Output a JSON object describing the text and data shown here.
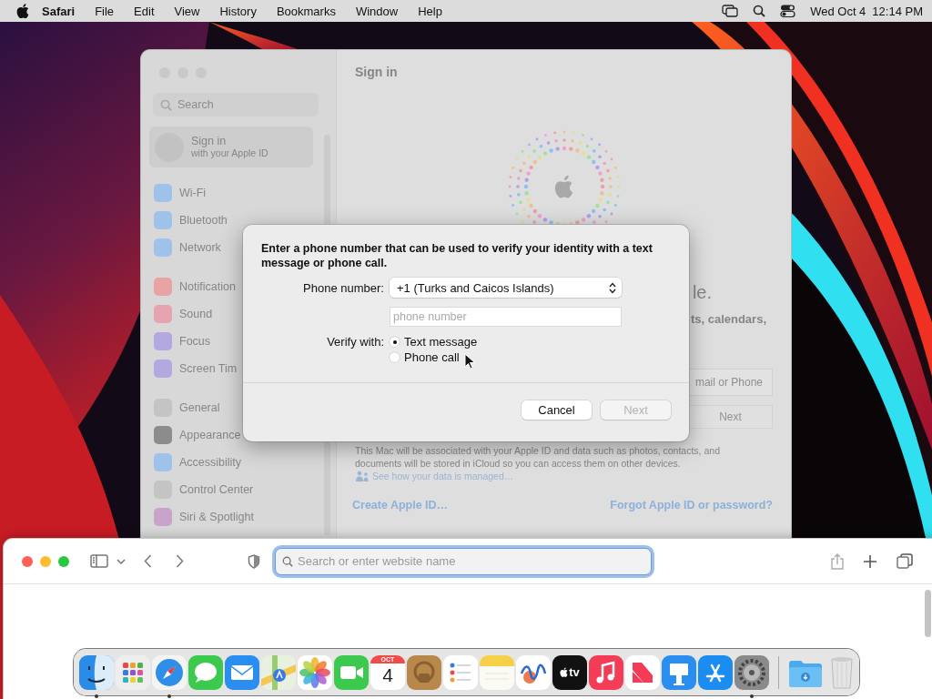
{
  "menu_bar": {
    "app_name": "Safari",
    "menus": [
      "File",
      "Edit",
      "View",
      "History",
      "Bookmarks",
      "Window",
      "Help"
    ],
    "date": "Wed Oct 4",
    "time": "12:14 PM"
  },
  "settings_window": {
    "active": false,
    "search": {
      "placeholder": "Search"
    },
    "account": {
      "title": "Sign in",
      "subtitle": "with your Apple ID"
    },
    "sidebar_groups": [
      [
        {
          "label": "Wi-Fi",
          "color": "#9fc2ea"
        },
        {
          "label": "Bluetooth",
          "color": "#9fc2ea"
        },
        {
          "label": "Network",
          "color": "#9fc2ea"
        }
      ],
      [
        {
          "label": "Notification",
          "color": "#e8a3a3"
        },
        {
          "label": "Sound",
          "color": "#e8a3b0"
        },
        {
          "label": "Focus",
          "color": "#b3a8e0"
        },
        {
          "label": "Screen Tim",
          "color": "#b3a8e0"
        }
      ],
      [
        {
          "label": "General",
          "color": "#c4c4c4"
        },
        {
          "label": "Appearance",
          "color": "#8c8c8c"
        },
        {
          "label": "Accessibility",
          "color": "#9fc2ea"
        },
        {
          "label": "Control Center",
          "color": "#c4c4c4"
        },
        {
          "label": "Siri & Spotlight",
          "color": "#c9a3c9"
        }
      ]
    ],
    "title": "Sign in",
    "headline_fragment": "le.",
    "subtitle_fragment": "ts, calendars,",
    "account_field": {
      "placeholder": "mail or Phone"
    },
    "next_button": {
      "label": "Next",
      "disabled": true
    },
    "info_text": "This Mac will be associated with your Apple ID and data such as photos, contacts, and documents will be stored in iCloud so you can access them on other devices.",
    "data_link": "See how your data is managed…",
    "create_link": "Create Apple ID…",
    "forgot_link": "Forgot Apple ID or password?"
  },
  "dialog": {
    "message": "Enter a phone number that can be used to verify your identity with a text message or phone call.",
    "phone_label": "Phone number:",
    "country": "+1 (Turks and Caicos Islands)",
    "phone_field": {
      "placeholder": "phone number"
    },
    "verify_label": "Verify with:",
    "verify_options": [
      {
        "label": "Text message",
        "selected": true
      },
      {
        "label": "Phone call",
        "selected": false
      }
    ],
    "buttons": [
      {
        "label": "Cancel",
        "disabled": false
      },
      {
        "label": "Next",
        "disabled": true
      }
    ]
  },
  "safari_window": {
    "address_field": {
      "placeholder": "Search or enter website name"
    }
  },
  "dock": {
    "items": [
      {
        "kind": "finder",
        "running": true
      },
      {
        "kind": "launchpad",
        "running": false
      },
      {
        "kind": "safari",
        "running": true
      },
      {
        "kind": "messages",
        "running": false
      },
      {
        "kind": "mail",
        "running": false
      },
      {
        "kind": "maps",
        "running": false
      },
      {
        "kind": "photos",
        "running": false
      },
      {
        "kind": "facetime",
        "running": false
      },
      {
        "kind": "calendar",
        "month": "OCT",
        "day": "4",
        "running": false
      },
      {
        "kind": "lock",
        "running": false
      },
      {
        "kind": "reminders",
        "running": false
      },
      {
        "kind": "notes",
        "running": false
      },
      {
        "kind": "freeform",
        "running": false
      },
      {
        "kind": "tv",
        "label": "tv",
        "running": false
      },
      {
        "kind": "music",
        "running": false
      },
      {
        "kind": "news",
        "running": false
      },
      {
        "kind": "keynote",
        "running": false
      },
      {
        "kind": "appstore",
        "running": false
      },
      {
        "kind": "settings",
        "running": true
      },
      {
        "kind": "separator"
      },
      {
        "kind": "folder",
        "running": false
      },
      {
        "kind": "trash",
        "running": false
      }
    ]
  }
}
